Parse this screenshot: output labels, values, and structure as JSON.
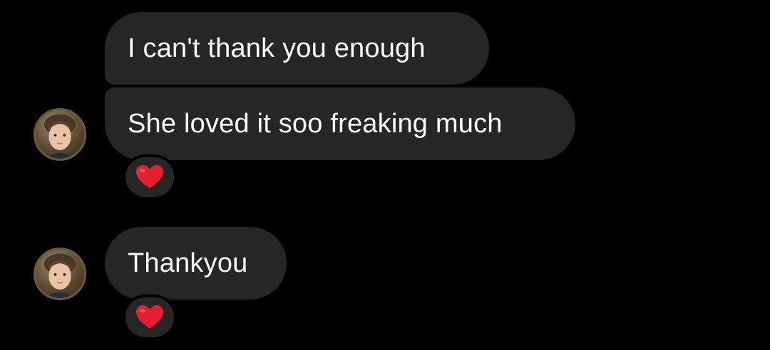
{
  "messages": [
    {
      "text": "I can't thank you enough",
      "has_avatar": false,
      "reaction": null
    },
    {
      "text": "She loved it soo freaking much",
      "has_avatar": true,
      "reaction": "heart-emoji"
    },
    {
      "text": "Thankyou",
      "has_avatar": true,
      "reaction": "heart-emoji"
    }
  ],
  "colors": {
    "background": "#000000",
    "bubble": "#262626",
    "text": "#ffffff",
    "heart": "#e5202e"
  }
}
